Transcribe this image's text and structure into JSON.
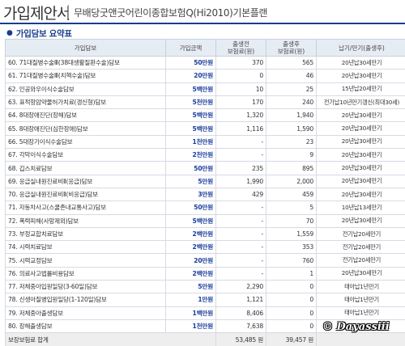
{
  "header": {
    "title": "가입제안서",
    "subtitle": "무배당굿앤굿어린이종합보험Q(Hi2010)기본플랜"
  },
  "section": {
    "title": "가입담보 요약표"
  },
  "table": {
    "headers": [
      "가입담보",
      "가입금액",
      "출생전\n보험료(원)",
      "출생후\n보험료(원)",
      "납기/만기(출생후)"
    ],
    "rows": [
      {
        "name": "60. 71대질병수술Ⅲ(38대생활질환수술)담보",
        "amount": "50만원",
        "pre": "370",
        "post": "565",
        "term": "20년납30세만기"
      },
      {
        "name": "61. 71대질병수술Ⅲ(치핵수술)담보",
        "amount": "20만원",
        "pre": "0",
        "post": "46",
        "term": "20년납30세만기"
      },
      {
        "name": "62. 인공와우이식수술담보",
        "amount": "5백만원",
        "pre": "10",
        "post": "25",
        "term": "15년납20세만기"
      },
      {
        "name": "63. 표적항암약물허가치료(갱신형)담보",
        "amount": "5천만원",
        "pre": "170",
        "post": "240",
        "term": "전기납10년만기갱신(최대30세)"
      },
      {
        "name": "64. 8대장애진단(장해)담보",
        "amount": "5백만원",
        "pre": "1,320",
        "post": "1,940",
        "term": "20년납30세만기"
      },
      {
        "name": "65. 8대장애진단(심한장애)담보",
        "amount": "5백만원",
        "pre": "1,116",
        "post": "1,590",
        "term": "20년납30세만기"
      },
      {
        "name": "66. 5대장기이식수술담보",
        "amount": "1천만원",
        "pre": "-",
        "post": "23",
        "term": "20년납30세만기"
      },
      {
        "name": "67. 각막이식수술담보",
        "amount": "2천만원",
        "pre": "-",
        "post": "9",
        "term": "20년납30세만기"
      },
      {
        "name": "68. 깁스치료담보",
        "amount": "50만원",
        "pre": "235",
        "post": "895",
        "term": "20년납30세만기"
      },
      {
        "name": "69. 응급실내원진료비Ⅱ(응급)담보",
        "amount": "5만원",
        "pre": "1,990",
        "post": "2,000",
        "term": "20년납30세만기"
      },
      {
        "name": "70. 응급실내원진료비Ⅱ(비응급)담보",
        "amount": "3만원",
        "pre": "429",
        "post": "459",
        "term": "20년납30세만기"
      },
      {
        "name": "71. 자동차사고(스쿨존내교통사고)담보",
        "amount": "50만원",
        "pre": "-",
        "post": "5",
        "term": "10년납13세만기"
      },
      {
        "name": "72. 폭력피해(사망제외)담보",
        "amount": "5백만원",
        "pre": "-",
        "post": "70",
        "term": "20년납30세만기"
      },
      {
        "name": "73. 부정교합치료담보",
        "amount": "2백만원",
        "pre": "-",
        "post": "1,559",
        "term": "전기납20세만기"
      },
      {
        "name": "74. 시력치료담보",
        "amount": "2백만원",
        "pre": "-",
        "post": "353",
        "term": "전기납20세만기"
      },
      {
        "name": "75. 시력교정담보",
        "amount": "20만원",
        "pre": "-",
        "post": "760",
        "term": "전기납20세만기"
      },
      {
        "name": "76. 의료사고법률비용담보",
        "amount": "2백만원",
        "pre": "-",
        "post": "1",
        "term": "20년납30세만기"
      },
      {
        "name": "77. 저체중아입원일당(3-60일)담보",
        "amount": "5만원",
        "pre": "2,290",
        "post": "0",
        "term": "태아납1년만기"
      },
      {
        "name": "78. 신생아질병입원일당(1-120일)담보",
        "amount": "1만원",
        "pre": "1,121",
        "post": "0",
        "term": "태아납1년만기"
      },
      {
        "name": "79. 저체중아출생담보",
        "amount": "1백만원",
        "pre": "8,406",
        "post": "0",
        "term": "태아납1년만기"
      },
      {
        "name": "80. 장해출생담보",
        "amount": "1천만원",
        "pre": "7,638",
        "post": "0",
        "term": "태아납1년만기"
      }
    ],
    "total": {
      "label": "보장보험료 합계",
      "pre": "53,485 원",
      "post": "39,457 원"
    }
  },
  "watermark": "© Dayassiii"
}
